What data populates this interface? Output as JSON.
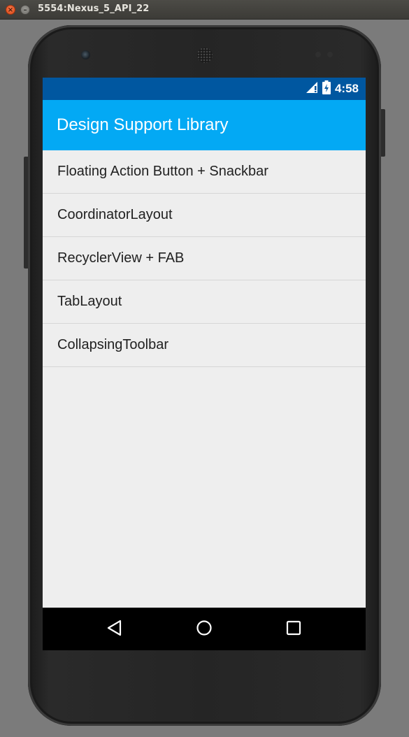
{
  "window": {
    "title": "5554:Nexus_5_API_22",
    "close_icon": "×",
    "minimize_icon": "–"
  },
  "status_bar": {
    "time": "4:58",
    "icons": [
      "signal-icon",
      "battery-icon"
    ]
  },
  "toolbar": {
    "title": "Design Support Library"
  },
  "list": {
    "items": [
      {
        "label": "Floating Action Button + Snackbar"
      },
      {
        "label": "CoordinatorLayout"
      },
      {
        "label": "RecyclerView + FAB"
      },
      {
        "label": "TabLayout"
      },
      {
        "label": "CollapsingToolbar"
      }
    ]
  },
  "nav_bar": {
    "buttons": [
      "back-icon",
      "home-icon",
      "recents-icon"
    ]
  },
  "colors": {
    "status_bar": "#0057a0",
    "toolbar": "#03a9f4",
    "background": "#eeeeee",
    "nav_bar": "#000000"
  }
}
